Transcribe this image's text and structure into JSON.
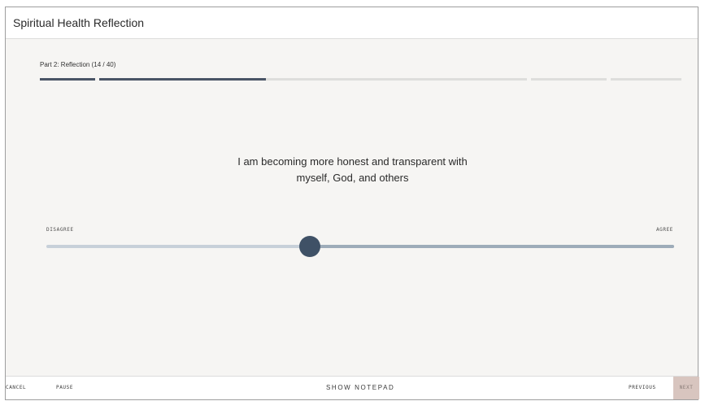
{
  "app": {
    "title": "Spiritual Health Reflection"
  },
  "progress": {
    "label": "Part 2: Reflection (14 / 40)",
    "segments": [
      {
        "fill": 1.0
      },
      {
        "fill": 0.39
      },
      {
        "fill": 0.0
      },
      {
        "fill": 0.0
      }
    ]
  },
  "question": {
    "line1": "I am becoming more honest and transparent with",
    "line2": "myself, God, and others"
  },
  "scale": {
    "min_label": "DISAGREE",
    "max_label": "AGREE",
    "value_fraction": 0.42
  },
  "footer": {
    "cancel": "CANCEL",
    "pause": "PAUSE",
    "notepad": "SHOW NOTEPAD",
    "previous": "PREVIOUS",
    "next": "NEXT"
  },
  "colors": {
    "progress_fill": "#4a5566",
    "slider_thumb": "#3f5166",
    "next_button_bg": "#d8c5bf"
  }
}
